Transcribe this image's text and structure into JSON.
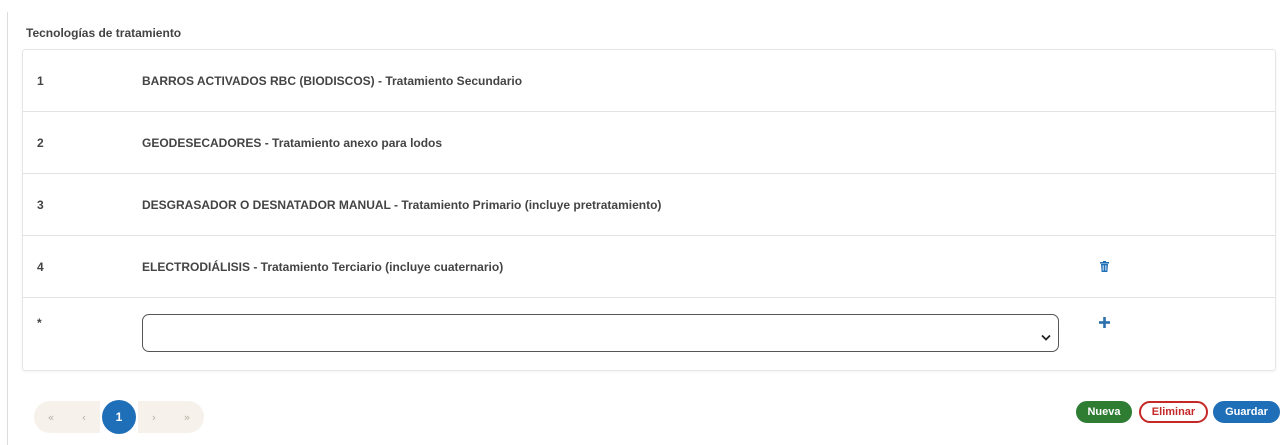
{
  "section": {
    "title": "Tecnologías de tratamiento"
  },
  "rows": [
    {
      "num": "1",
      "text": "BARROS ACTIVADOS RBC (BIODISCOS) - Tratamiento Secundario"
    },
    {
      "num": "2",
      "text": "GEODESECADORES - Tratamiento anexo para lodos"
    },
    {
      "num": "3",
      "text": "DESGRASADOR O DESNATADOR MANUAL - Tratamiento Primario (incluye pretratamiento)"
    },
    {
      "num": "4",
      "text": "ELECTRODIÁLISIS - Tratamiento Terciario (incluye cuaternario)"
    }
  ],
  "new_row": {
    "num": "*",
    "selected": ""
  },
  "pagination": {
    "first": "«",
    "prev": "‹",
    "current": "1",
    "next": "›",
    "last": "»"
  },
  "actions": {
    "nueva": "Nueva",
    "eliminar": "Eliminar",
    "guardar": "Guardar"
  },
  "colors": {
    "accent": "#1f6fb8",
    "success": "#2e7d32",
    "danger": "#c62828"
  },
  "icons": {
    "delete": "trash-icon",
    "add": "plus-icon",
    "dropdown": "chevron-down-icon"
  }
}
